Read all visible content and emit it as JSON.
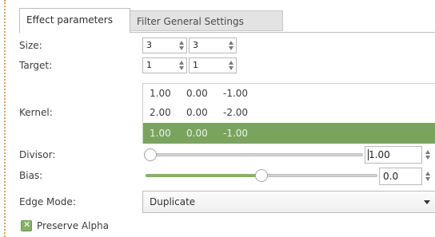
{
  "tabs": {
    "effect_parameters": "Effect parameters",
    "filter_general_settings": "Filter General Settings"
  },
  "labels": {
    "size": "Size:",
    "target": "Target:",
    "kernel": "Kernel:",
    "divisor": "Divisor:",
    "bias": "Bias:",
    "edge_mode": "Edge Mode:",
    "preserve_alpha": "Preserve Alpha"
  },
  "size": {
    "x": "3",
    "y": "3"
  },
  "target": {
    "x": "1",
    "y": "1"
  },
  "kernel": {
    "rows": [
      [
        "1.00",
        "0.00",
        "-1.00"
      ],
      [
        "2.00",
        "0.00",
        "-2.00"
      ],
      [
        "1.00",
        "0.00",
        "-1.00"
      ]
    ],
    "selected_row": 2
  },
  "divisor": {
    "value": "1.00",
    "slider_fraction": 0.0
  },
  "bias": {
    "value": "0.0",
    "slider_fraction": 0.5
  },
  "edge_mode": {
    "value": "Duplicate"
  },
  "preserve_alpha": {
    "checked": true,
    "mark": "✕"
  },
  "colors": {
    "accent": "#7aa45e",
    "selected_text": "#eaf3e4",
    "dotted_border": "#e0a05a"
  }
}
